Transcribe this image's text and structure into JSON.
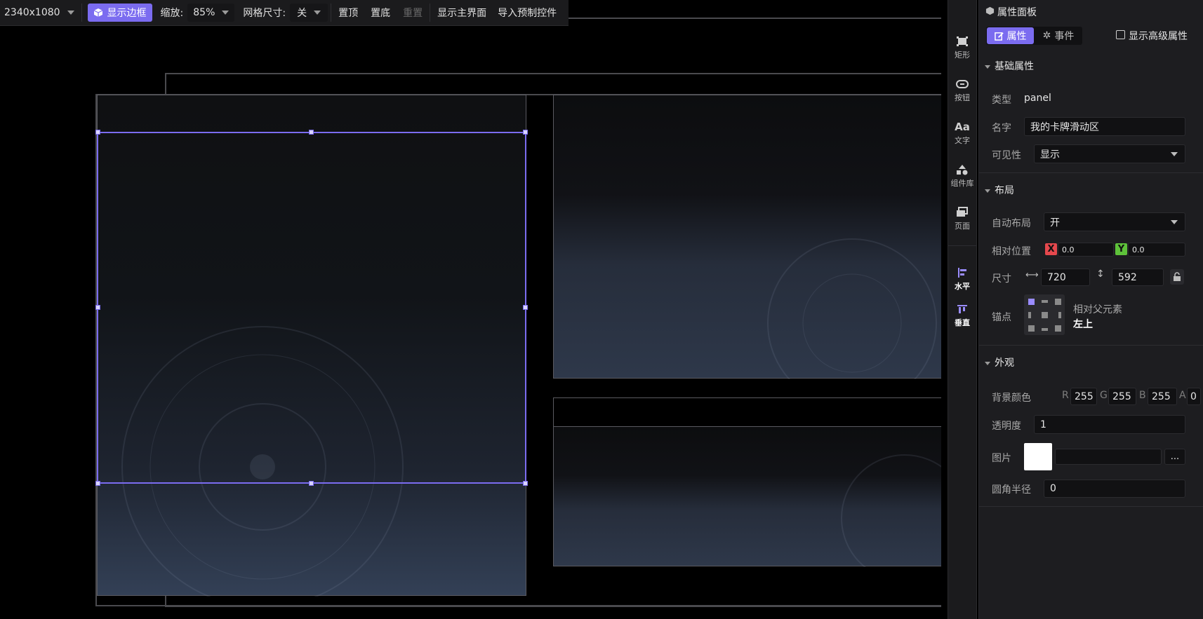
{
  "toolbar": {
    "resolution": "2340x1080",
    "show_border": "显示边框",
    "zoom_label": "缩放:",
    "zoom_value": "85%",
    "grid_label": "网格尺寸:",
    "grid_value": "关",
    "btn_top": "置顶",
    "btn_bottom": "置底",
    "btn_reset": "重置",
    "btn_main": "显示主界面",
    "btn_import": "导入预制控件"
  },
  "tools": {
    "rect": "矩形",
    "button": "按钮",
    "text": "文字",
    "library": "组件库",
    "page": "页面",
    "horizontal": "水平",
    "vertical": "垂直"
  },
  "props": {
    "title": "属性面板",
    "tab_props": "属性",
    "tab_events": "事件",
    "advanced": "显示高级属性",
    "basic": {
      "header": "基础属性",
      "type_label": "类型",
      "type_value": "panel",
      "name_label": "名字",
      "name_value": "我的卡牌滑动区",
      "visible_label": "可见性",
      "visible_value": "显示"
    },
    "layout": {
      "header": "布局",
      "auto_label": "自动布局",
      "auto_value": "开",
      "pos_label": "相对位置",
      "x_badge": "X",
      "x_value": "0.0",
      "y_badge": "Y",
      "y_value": "0.0",
      "size_label": "尺寸",
      "w_value": "720",
      "h_value": "592",
      "anchor_label": "锚点",
      "anchor_rel": "相对父元素",
      "anchor_value": "左上"
    },
    "appearance": {
      "header": "外观",
      "bg_label": "背景颜色",
      "r_label": "R",
      "r_value": "255",
      "g_label": "G",
      "g_value": "255",
      "b_label": "B",
      "b_value": "255",
      "a_label": "A",
      "a_value": "0",
      "opacity_label": "透明度",
      "opacity_value": "1",
      "image_label": "图片",
      "image_btn": "...",
      "radius_label": "圆角半径",
      "radius_value": "0"
    }
  },
  "colors": {
    "accent": "#7b6cf0",
    "x_badge": "#e5484d",
    "y_badge": "#5ec23a"
  }
}
